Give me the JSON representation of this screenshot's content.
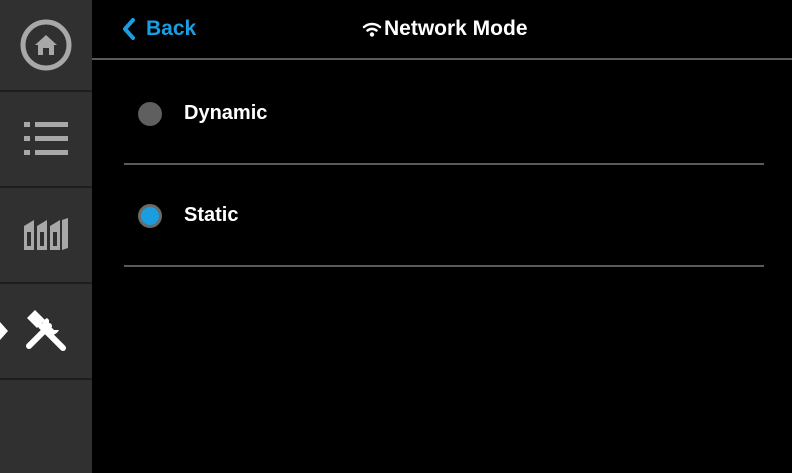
{
  "sidebar": {
    "items": [
      {
        "icon": "home-icon"
      },
      {
        "icon": "list-icon"
      },
      {
        "icon": "materials-icon"
      },
      {
        "icon": "tools-icon",
        "active": true
      }
    ]
  },
  "header": {
    "back_label": "Back",
    "title": "Network Mode"
  },
  "options": [
    {
      "label": "Dynamic",
      "selected": false
    },
    {
      "label": "Static",
      "selected": true
    }
  ],
  "colors": {
    "accent": "#1a9ee0",
    "sidebar_bg": "#303030",
    "background": "#000000",
    "divider": "#5a5a5a"
  }
}
